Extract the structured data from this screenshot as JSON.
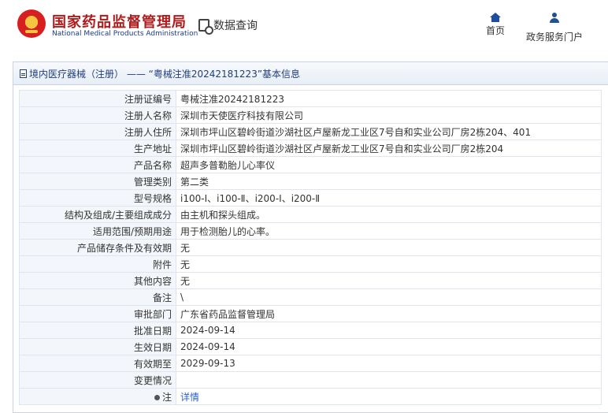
{
  "header": {
    "brand_cn": "国家药品监督管理局",
    "brand_en": "National Medical Products Administration",
    "query_label": "数据查询",
    "nav": {
      "home": "首页",
      "user_center": "政务服务门户"
    }
  },
  "panel": {
    "title": "境内医疗器械（注册） —— “粤械注准20242181223”基本信息"
  },
  "rows": [
    {
      "label": "注册证编号",
      "value": "粤械注准20242181223"
    },
    {
      "label": "注册人名称",
      "value": "深圳市天使医疗科技有限公司"
    },
    {
      "label": "注册人住所",
      "value": "深圳市坪山区碧岭街道沙湖社区卢屋新龙工业区7号自和实业公司厂房2栋204、401"
    },
    {
      "label": "生产地址",
      "value": "深圳市坪山区碧岭街道沙湖社区卢屋新龙工业区7号自和实业公司厂房2栋204"
    },
    {
      "label": "产品名称",
      "value": "超声多普勒胎儿心率仪"
    },
    {
      "label": "管理类别",
      "value": "第二类"
    },
    {
      "label": "型号规格",
      "value": "i100-Ⅰ、i100-Ⅱ、i200-Ⅰ、i200-Ⅱ"
    },
    {
      "label": "结构及组成/主要组成成分",
      "value": "由主机和探头组成。"
    },
    {
      "label": "适用范围/预期用途",
      "value": "用于检测胎儿的心率。"
    },
    {
      "label": "产品储存条件及有效期",
      "value": "无"
    },
    {
      "label": "附件",
      "value": "无"
    },
    {
      "label": "其他内容",
      "value": "无"
    },
    {
      "label": "备注",
      "value": "\\"
    },
    {
      "label": "审批部门",
      "value": "广东省药品监督管理局"
    },
    {
      "label": "批准日期",
      "value": "2024-09-14"
    },
    {
      "label": "生效日期",
      "value": "2024-09-14"
    },
    {
      "label": "有效期至",
      "value": "2029-09-13"
    },
    {
      "label": "变更情况",
      "value": ""
    }
  ],
  "note_row": {
    "label": "注",
    "link": "详情"
  }
}
